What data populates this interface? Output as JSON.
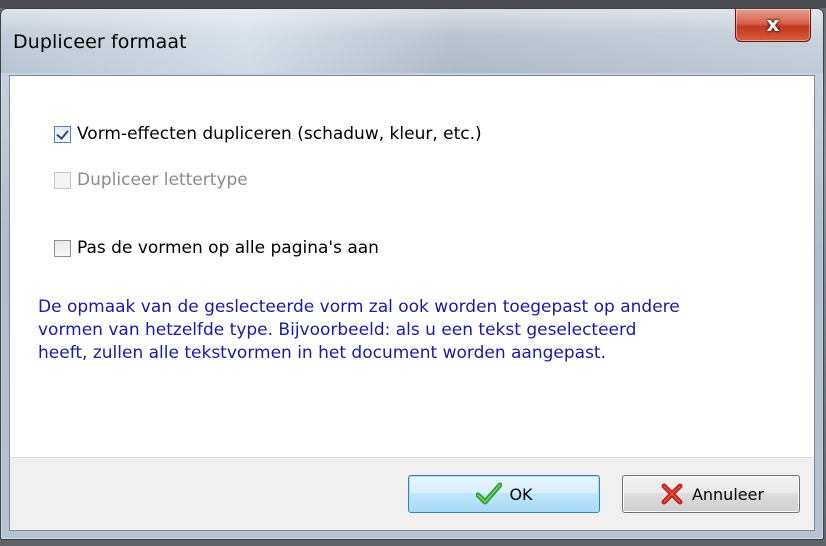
{
  "window": {
    "title": "Dupliceer formaat",
    "close_label": "x"
  },
  "options": [
    {
      "label": "Vorm-effecten dupliceren (schaduw, kleur, etc.)",
      "checked": true,
      "enabled": true
    },
    {
      "label": "Dupliceer lettertype",
      "checked": false,
      "enabled": false
    },
    {
      "label": "Pas de vormen op alle pagina's aan",
      "checked": false,
      "enabled": true
    }
  ],
  "info": {
    "line1": "De opmaak van de geslecteerde vorm zal ook worden toegepast op andere",
    "line2": "vormen van hetzelfde type. Bijvoorbeeld: als u een tekst geselecteerd",
    "line3": "heeft, zullen alle tekstvormen in het document worden aangepast."
  },
  "buttons": {
    "ok_label": "OK",
    "ok_icon": "checkmark-icon",
    "cancel_label": "Annuleer",
    "cancel_icon": "red-x-icon"
  },
  "colors": {
    "info_text": "#1a1aa6",
    "ok_icon": "#2f9e2a",
    "cancel_icon": "#c0201a"
  }
}
